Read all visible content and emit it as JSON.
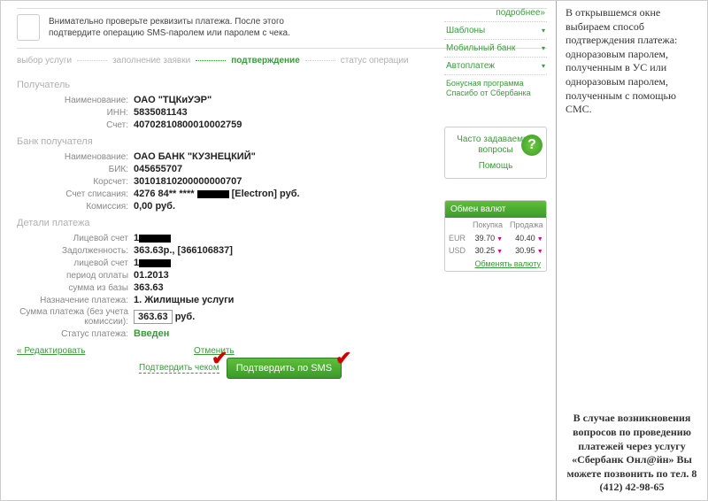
{
  "info_text": "Внимательно проверьте реквизиты платежа. После этого подтвердите операцию SMS-паролем или паролем с чека.",
  "steps": {
    "s1": "выбор услуги",
    "s2": "заполнение заявки",
    "s3": "подтверждение",
    "s4": "статус операции"
  },
  "sections": {
    "recipient_title": "Получатель",
    "bank_title": "Банк получателя",
    "details_title": "Детали платежа"
  },
  "recipient": {
    "name_label": "Наименование:",
    "name": "ОАО \"ТЦКиУЭР\"",
    "inn_label": "ИНН:",
    "inn": "5835081143",
    "account_label": "Счет:",
    "account": "40702810800010002759"
  },
  "bank": {
    "name_label": "Наименование:",
    "name": "ОАО БАНК \"КУЗНЕЦКИЙ\"",
    "bik_label": "БИК:",
    "bik": "045655707",
    "corr_label": "Корсчет:",
    "corr": "30101810200000000707",
    "debit_label": "Счет списания:",
    "debit": "4276 84** **** ",
    "debit_suffix": " [Electron]  руб.",
    "fee_label": "Комиссия:",
    "fee": "0,00 руб."
  },
  "details": {
    "acc1_label": "Лицевой счет",
    "acc1": "1",
    "debt_label": "Задолженность:",
    "debt": "363.63р., [366106837]",
    "acc2_label": "лицевой счет",
    "acc2": "1",
    "period_label": "период оплаты",
    "period": "01.2013",
    "base_label": "сумма из базы",
    "base": "363.63",
    "purpose_label": "Назначение платежа:",
    "purpose": "1. Жилищные услуги",
    "amount_label": "Сумма платежа (без учета комиссии):",
    "amount": "363.63",
    "amount_suffix": " руб.",
    "status_label": "Статус платежа:",
    "status": "Введен"
  },
  "actions": {
    "edit": "« Редактировать",
    "cancel": "Отменить",
    "confirm_cheque": "Подтвердить чеком",
    "confirm_sms": "Подтвердить по SMS"
  },
  "sidebar": {
    "more": "подробнее»",
    "items": [
      "Шаблоны",
      "Мобильный банк",
      "Автоплатеж"
    ],
    "bonus": "Бонусная программа Спасибо от Сбербанка",
    "faq": "Часто задаваемые вопросы",
    "help": "Помощь",
    "fx_title": "Обмен валют",
    "fx_buy": "Покупка",
    "fx_sell": "Продажа",
    "fx_rows": [
      {
        "cur": "EUR",
        "buy": "39.70",
        "sell": "40.40"
      },
      {
        "cur": "USD",
        "buy": "30.25",
        "sell": "30.95"
      }
    ],
    "fx_link": "Обменять валюту"
  },
  "instructions": {
    "top": "В открывшемся окне выбираем способ подтверждения платежа: одноразовым паролем, полученным в УС или одноразовым паролем, полученным с помощью СМС.",
    "bottom": "В случае возникновения вопросов по проведению платежей через услугу «Сбербанк Онл@йн» Вы можете позвонить по тел. 8 (412) 42-98-65"
  }
}
